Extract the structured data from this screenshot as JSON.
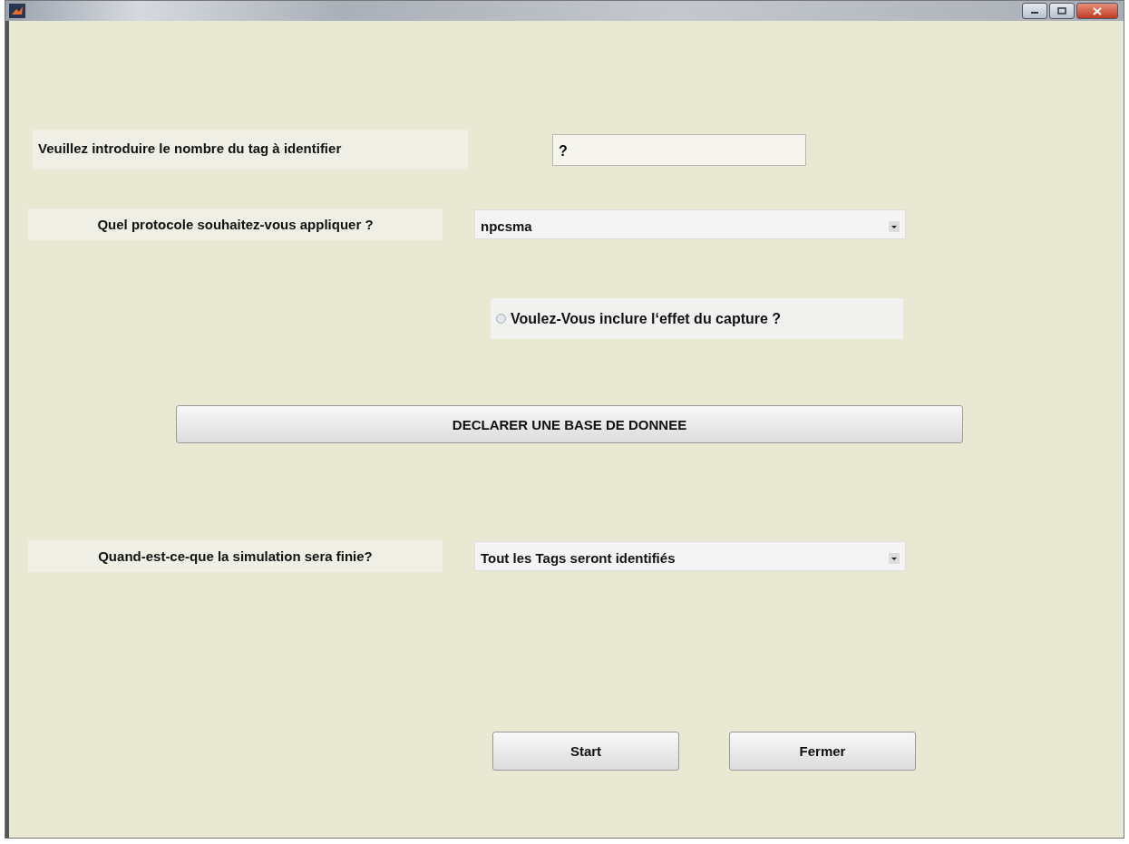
{
  "count_prompt": {
    "label": "Veuillez introduire le nombre du tag à identifier",
    "value": "?"
  },
  "protocol": {
    "label": "Quel protocole souhaitez-vous appliquer ?",
    "value": "npcsma"
  },
  "capture_option": {
    "label": "Voulez-Vous inclure l‘effet du capture ?",
    "checked": false
  },
  "database_button": "DECLARER UNE BASE DE DONNEE",
  "end_condition": {
    "label": "Quand-est-ce-que la simulation sera finie?",
    "value": "Tout les Tags seront identifiés"
  },
  "buttons": [
    "Start",
    "Fermer"
  ]
}
